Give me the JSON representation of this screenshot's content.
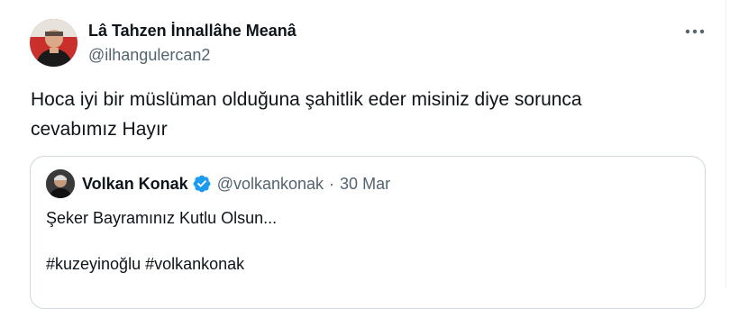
{
  "tweet": {
    "display_name": "Lâ Tahzen İnnallâhe Meanâ",
    "handle": "@ilhangulercan2",
    "text_line_1": "Hoca iyi bir müslüman olduğuna şahitlik eder misiniz diye sorunca",
    "text_line_2": "cevabımız Hayır",
    "more_icon": "more-horizontal-icon"
  },
  "quote": {
    "display_name": "Volkan Konak",
    "verified_icon": "verified-badge-icon",
    "handle": "@volkankonak",
    "separator": "·",
    "date": "30 Mar",
    "line_1": "Şeker Bayramınız Kutlu Olsun...",
    "line_2": "#kuzeyinoğlu #volkankonak"
  },
  "colors": {
    "text_primary": "#0f1419",
    "text_secondary": "#536471",
    "border": "#cfd9de",
    "verified_blue": "#1d9bf0"
  }
}
